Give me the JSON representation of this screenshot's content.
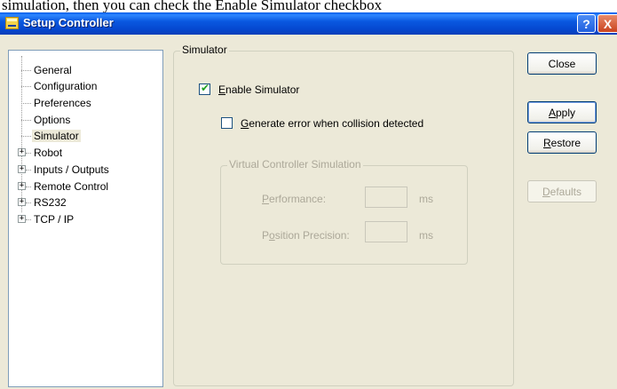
{
  "caption": {
    "text": "simulation, then you can check the Enable Simulator checkbox"
  },
  "window": {
    "title": "Setup Controller",
    "help_button": "?",
    "close_button": "X"
  },
  "tree": {
    "items": [
      {
        "label": "General",
        "expandable": false
      },
      {
        "label": "Configuration",
        "expandable": false
      },
      {
        "label": "Preferences",
        "expandable": false
      },
      {
        "label": "Options",
        "expandable": false
      },
      {
        "label": "Simulator",
        "expandable": false,
        "selected": true
      },
      {
        "label": "Robot",
        "expandable": true
      },
      {
        "label": "Inputs / Outputs",
        "expandable": true
      },
      {
        "label": "Remote Control",
        "expandable": true
      },
      {
        "label": "RS232",
        "expandable": true
      },
      {
        "label": "TCP / IP",
        "expandable": true
      }
    ],
    "expander_glyph": "+"
  },
  "simulator": {
    "group_title": "Simulator",
    "enable_simulator": {
      "mnemonic": "E",
      "rest": "nable Simulator",
      "checked": true
    },
    "generate_error": {
      "mnemonic": "G",
      "rest": "enerate error when collision detected",
      "checked": false
    },
    "virtual_group_title": "Virtual Controller Simulation",
    "performance": {
      "mnemonic": "P",
      "rest": "erformance:",
      "value": "",
      "unit": "ms"
    },
    "position_precision": {
      "prefix": "P",
      "mnemonic": "o",
      "rest": "sition Precision:",
      "value": "",
      "unit": "ms"
    }
  },
  "buttons": {
    "close": {
      "label": "Close"
    },
    "apply": {
      "mnemonic": "A",
      "rest": "pply"
    },
    "restore": {
      "mnemonic": "R",
      "rest": "estore"
    },
    "defaults": {
      "mnemonic": "D",
      "rest": "efaults",
      "enabled": false
    }
  },
  "colors": {
    "titlebar": "#0a58e0",
    "dialog_bg": "#ece9d8",
    "check_mark": "#21a121",
    "disabled_text": "#aca899"
  }
}
